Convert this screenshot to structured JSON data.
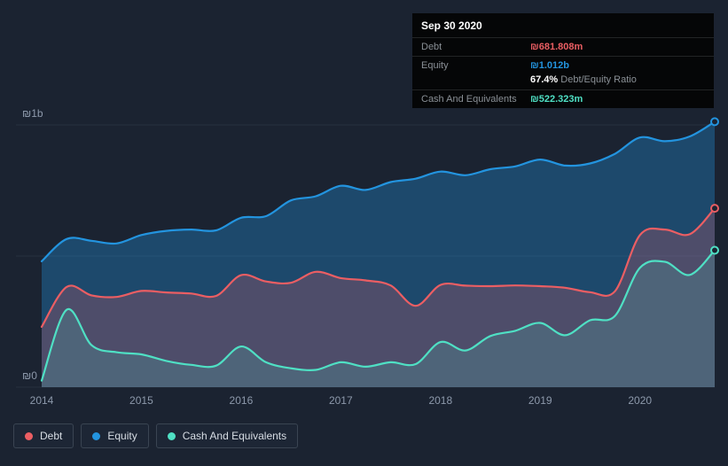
{
  "colors": {
    "debt": "#eb5e63",
    "equity": "#2394df",
    "cash": "#4fe0c4",
    "background": "#1b2331",
    "grid": "#273140",
    "axis_text": "#8d99ab"
  },
  "tooltip": {
    "date": "Sep 30 2020",
    "debt_label": "Debt",
    "debt_value": "₪681.808m",
    "equity_label": "Equity",
    "equity_value": "₪1.012b",
    "ratio_value": "67.4%",
    "ratio_label": " Debt/Equity Ratio",
    "cash_label": "Cash And Equivalents",
    "cash_value": "₪522.323m"
  },
  "legend": [
    {
      "id": "debt",
      "label": "Debt"
    },
    {
      "id": "equity",
      "label": "Equity"
    },
    {
      "id": "cash",
      "label": "Cash And Equivalents"
    }
  ],
  "chart_data": {
    "type": "area",
    "title": "Debt to Equity History",
    "unit": "ILS millions (₪m)",
    "x": [
      2014,
      2014.25,
      2014.5,
      2014.75,
      2015,
      2015.25,
      2015.5,
      2015.75,
      2016,
      2016.25,
      2016.5,
      2016.75,
      2017,
      2017.25,
      2017.5,
      2017.75,
      2018,
      2018.25,
      2018.5,
      2018.75,
      2019,
      2019.25,
      2019.5,
      2019.75,
      2020,
      2020.25,
      2020.5,
      2020.75
    ],
    "series": [
      {
        "id": "equity",
        "name": "Equity",
        "values": [
          480,
          565,
          558,
          548,
          580,
          596,
          601,
          598,
          646,
          652,
          712,
          728,
          768,
          752,
          782,
          795,
          822,
          808,
          831,
          842,
          868,
          845,
          853,
          890,
          952,
          938,
          956,
          1012
        ]
      },
      {
        "id": "debt",
        "name": "Debt",
        "values": [
          230,
          382,
          350,
          344,
          367,
          361,
          357,
          348,
          427,
          403,
          398,
          440,
          416,
          407,
          388,
          310,
          390,
          387,
          385,
          388,
          385,
          379,
          362,
          366,
          580,
          601,
          583,
          682
        ]
      },
      {
        "id": "cash",
        "name": "Cash And Equivalents",
        "values": [
          25,
          295,
          160,
          133,
          125,
          100,
          85,
          82,
          155,
          95,
          72,
          66,
          95,
          78,
          95,
          88,
          172,
          140,
          195,
          215,
          245,
          198,
          255,
          272,
          455,
          478,
          428,
          522
        ]
      }
    ],
    "ylim": [
      0,
      1060
    ],
    "y_gridlines": [
      {
        "value": 1000,
        "label": "₪1b"
      },
      {
        "value": 500,
        "label": ""
      },
      {
        "value": 0,
        "label": "₪0"
      }
    ],
    "x_ticks": [
      2014,
      2015,
      2016,
      2017,
      2018,
      2019,
      2020
    ],
    "last_point_date": "Sep 30 2020",
    "legend_position": "bottom-left",
    "grid": true
  }
}
